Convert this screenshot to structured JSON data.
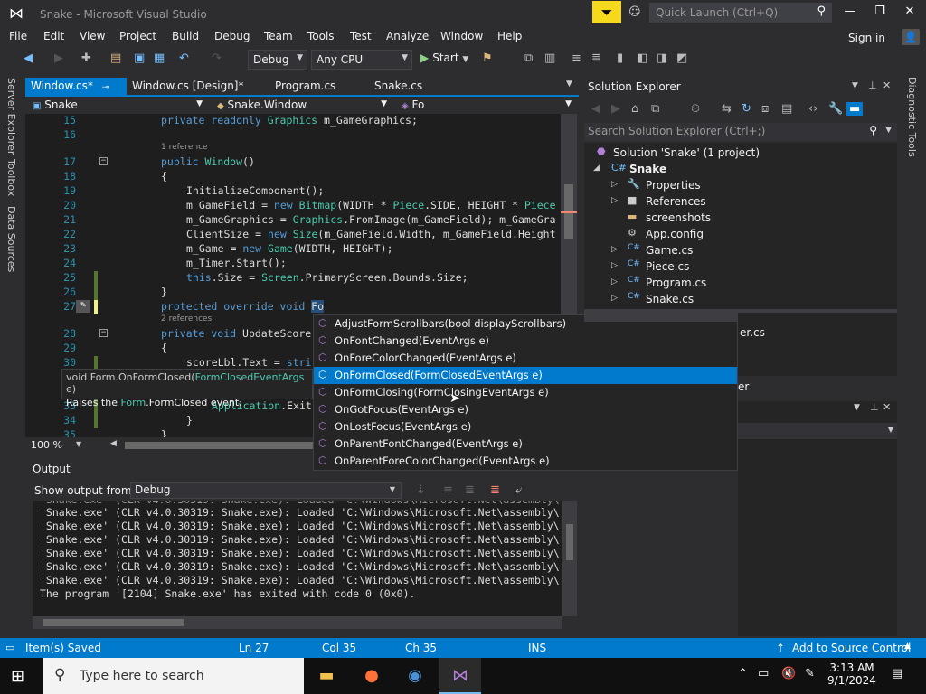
{
  "window": {
    "title": "Snake - Microsoft Visual Studio"
  },
  "quick_launch": {
    "placeholder": "Quick Launch (Ctrl+Q)"
  },
  "menu": [
    "File",
    "Edit",
    "View",
    "Project",
    "Build",
    "Debug",
    "Team",
    "Tools",
    "Test",
    "Analyze",
    "Window",
    "Help"
  ],
  "account": {
    "signin": "Sign in"
  },
  "toolbar": {
    "config": "Debug",
    "platform": "Any CPU",
    "start": "Start"
  },
  "left_tabs": [
    "Server Explorer",
    "Toolbox",
    "Data Sources"
  ],
  "right_tabs": [
    "Diagnostic Tools"
  ],
  "doc_tabs": [
    {
      "label": "Window.cs*",
      "active": true
    },
    {
      "label": "Window.cs [Design]*",
      "active": false
    },
    {
      "label": "Program.cs",
      "active": false
    },
    {
      "label": "Snake.cs",
      "active": false
    }
  ],
  "navbar": {
    "project": "Snake",
    "class": "Snake.Window",
    "member": "Fo"
  },
  "code_lines": [
    {
      "num": "15",
      "text": "private readonly Graphics m_GameGraphics;"
    },
    {
      "num": "16",
      "text": ""
    },
    {
      "num": "17",
      "text": "public Window()",
      "ref": "1 reference"
    },
    {
      "num": "18",
      "text": "{"
    },
    {
      "num": "19",
      "text": "InitializeComponent();"
    },
    {
      "num": "20",
      "text": "m_GameField = new Bitmap(WIDTH * Piece.SIDE, HEIGHT * Piece"
    },
    {
      "num": "21",
      "text": "m_GameGraphics = Graphics.FromImage(m_GameField); m_GameGra"
    },
    {
      "num": "22",
      "text": "ClientSize = new Size(m_GameField.Width, m_GameField.Height"
    },
    {
      "num": "23",
      "text": "m_Game = new Game(WIDTH, HEIGHT);"
    },
    {
      "num": "24",
      "text": "m_Timer.Start();"
    },
    {
      "num": "25",
      "text": "this.Size = Screen.PrimaryScreen.Bounds.Size;"
    },
    {
      "num": "26",
      "text": "}"
    },
    {
      "num": "27",
      "text": "protected override void Fo"
    },
    {
      "num": "28",
      "text": "private void UpdateScore",
      "ref": "2 references"
    },
    {
      "num": "29",
      "text": "{"
    },
    {
      "num": "30",
      "text": "scoreLbl.Text = stri"
    },
    {
      "num": "33",
      "text": "Application.Exit"
    },
    {
      "num": "34",
      "text": "}"
    },
    {
      "num": "35",
      "text": "}"
    }
  ],
  "zoom": "100 %",
  "tooltip": {
    "signature_pre": "void Form.",
    "signature_method": "OnFormClosed(",
    "signature_type": "FormClosedEventArgs",
    "signature_post": " e)",
    "desc_pre": "Raises the ",
    "desc_link": "Form",
    "desc_post": ".FormClosed event."
  },
  "completion": [
    {
      "label": "AdjustFormScrollbars(bool displayScrollbars)",
      "selected": false
    },
    {
      "label": "OnFontChanged(EventArgs e)",
      "selected": false
    },
    {
      "label": "OnForeColorChanged(EventArgs e)",
      "selected": false
    },
    {
      "label": "OnFormClosed(FormClosedEventArgs e)",
      "selected": true
    },
    {
      "label": "OnFormClosing(FormClosingEventArgs e)",
      "selected": false
    },
    {
      "label": "OnGotFocus(EventArgs e)",
      "selected": false
    },
    {
      "label": "OnLostFocus(EventArgs e)",
      "selected": false
    },
    {
      "label": "OnParentFontChanged(EventArgs e)",
      "selected": false
    },
    {
      "label": "OnParentForeColorChanged(EventArgs e)",
      "selected": false
    }
  ],
  "solution_explorer": {
    "title": "Solution Explorer",
    "search_placeholder": "Search Solution Explorer (Ctrl+;)",
    "items": [
      {
        "label": "Solution 'Snake' (1 project)",
        "icon": "solution-icon"
      },
      {
        "label": "Snake",
        "icon": "csharp-project-icon"
      },
      {
        "label": "Properties",
        "icon": "wrench-icon"
      },
      {
        "label": "References",
        "icon": "references-icon"
      },
      {
        "label": "screenshots",
        "icon": "folder-icon"
      },
      {
        "label": "App.config",
        "icon": "config-icon"
      },
      {
        "label": "Game.cs",
        "icon": "csharp-file-icon"
      },
      {
        "label": "Piece.cs",
        "icon": "csharp-file-icon"
      },
      {
        "label": "Program.cs",
        "icon": "csharp-file-icon"
      },
      {
        "label": "Snake.cs",
        "icon": "csharp-file-icon"
      }
    ],
    "partial_item": "er.cs",
    "sub_panel_partial": "er"
  },
  "output": {
    "title": "Output",
    "show_from_label": "Show output from:",
    "show_from_value": "Debug",
    "lines": [
      "'Snake.exe' (CLR v4.0.30319: Snake.exe): Loaded 'C:\\Windows\\Microsoft.Net\\assembly\\",
      "'Snake.exe' (CLR v4.0.30319: Snake.exe): Loaded 'C:\\Windows\\Microsoft.Net\\assembly\\",
      "'Snake.exe' (CLR v4.0.30319: Snake.exe): Loaded 'C:\\Windows\\Microsoft.Net\\assembly\\",
      "'Snake.exe' (CLR v4.0.30319: Snake.exe): Loaded 'C:\\Windows\\Microsoft.Net\\assembly\\",
      "'Snake.exe' (CLR v4.0.30319: Snake.exe): Loaded 'C:\\Windows\\Microsoft.Net\\assembly\\",
      "'Snake.exe' (CLR v4.0.30319: Snake.exe): Loaded 'C:\\Windows\\Microsoft.Net\\assembly\\",
      "The program '[2104] Snake.exe' has exited with code 0 (0x0)."
    ]
  },
  "status": {
    "message": "Item(s) Saved",
    "line": "Ln 27",
    "col": "Col 35",
    "ch": "Ch 35",
    "mode": "INS",
    "source_control": "Add to Source Control"
  },
  "taskbar": {
    "search_placeholder": "Type here to search",
    "time": "3:13 AM",
    "date": "9/1/2024"
  }
}
